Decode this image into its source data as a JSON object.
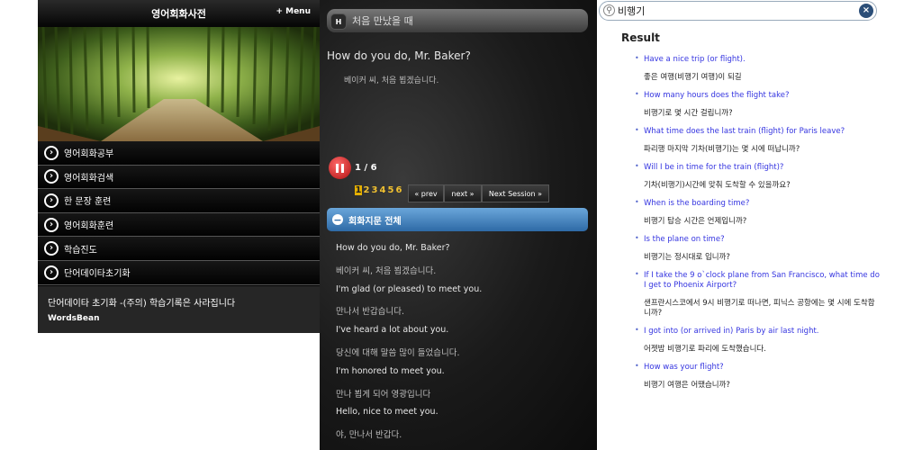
{
  "app": {
    "title": "영어회화사전",
    "menu_label": "+ Menu",
    "menu_items": [
      {
        "label": "영어회화공부"
      },
      {
        "label": "영어회화검색"
      },
      {
        "label": "한 문장 훈련"
      },
      {
        "label": "영어회화훈련"
      },
      {
        "label": "학습진도"
      },
      {
        "label": "단어데이타초기화"
      }
    ],
    "notice": "단어데이타 초기화 -(주의) 학습기록은 사라집니다",
    "brand": "WordsBean"
  },
  "study": {
    "badge": "H",
    "session_title": "처음 만났을 때",
    "current_english": "How do you do, Mr. Baker?",
    "current_korean": "베이커 씨, 처음 뵙겠습니다.",
    "counter": "1 / 6",
    "pages": [
      "1",
      "2",
      "3",
      "4",
      "5",
      "6"
    ],
    "active_page": "1",
    "prev_label": "« prev",
    "next_label": "next »",
    "next_session_label": "Next Session »",
    "section_title": "회화지문 전체",
    "section_icon": "minus-icon",
    "dialogue": [
      {
        "en": "How do you do, Mr. Baker?",
        "ko": "베이커 씨, 처음 뵙겠습니다."
      },
      {
        "en": "I'm glad (or pleased) to meet you.",
        "ko": "만나서 반갑습니다."
      },
      {
        "en": "I've heard a lot about you.",
        "ko": "당신에 대해 말씀 많이 들었습니다."
      },
      {
        "en": "I'm honored to meet you.",
        "ko": "만나 뵙게 되어 영광입니다"
      },
      {
        "en": "Hello, nice to meet you.",
        "ko": "야, 만나서 반갑다."
      }
    ]
  },
  "search": {
    "query": "비행기",
    "result_heading": "Result",
    "results": [
      {
        "q": "Have a nice trip (or flight).",
        "a": "좋은 여행(비행기 여행)이 되길"
      },
      {
        "q": "How many hours does the flight take?",
        "a": "비행기로 몇 시간 걸립니까?"
      },
      {
        "q": "What time does the last train (flight) for Paris leave?",
        "a": "파리행 마지막 기차(비행기)는 몇 시에 떠납니까?"
      },
      {
        "q": "Will I be in time for the train (flight)?",
        "a": "기차(비행기)시간에 맞춰 도착할 수 있을까요?"
      },
      {
        "q": "When is the boarding time?",
        "a": "비행기 탑승 시간은 언제입니까?"
      },
      {
        "q": "Is the plane on time?",
        "a": "비행기는 정시대로 입니까?"
      },
      {
        "q": "If I take the 9 o`clock plane from San Francisco, what time do I get to Phoenix Airport?",
        "a": "샌프란시스코에서 9시 비행기로 떠나면, 피닉스 공항에는 몇 시에 도착합니까?"
      },
      {
        "q": "I got into (or arrived in) Paris by air last night.",
        "a": "어젯밤 비행기로 파리에 도착했습니다."
      },
      {
        "q": "How was your flight?",
        "a": "비행기 여행은 어땠습니까?"
      }
    ]
  }
}
